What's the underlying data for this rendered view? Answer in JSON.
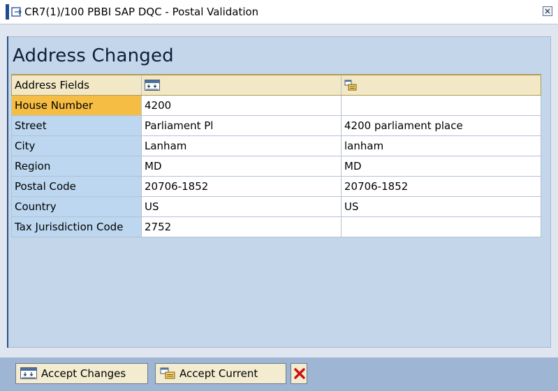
{
  "window": {
    "title": "CR7(1)/100 PBBI SAP DQC - Postal Validation"
  },
  "main": {
    "heading": "Address Changed"
  },
  "table": {
    "header": {
      "label": "Address Fields",
      "proposed_icon": "accept-changes-icon",
      "current_icon": "accept-current-icon"
    },
    "rows": [
      {
        "field": "House Number",
        "proposed": "4200",
        "current": "",
        "selected": true
      },
      {
        "field": "Street",
        "proposed": "Parliament Pl",
        "current": "4200 parliament place"
      },
      {
        "field": "City",
        "proposed": "Lanham",
        "current": "lanham"
      },
      {
        "field": "Region",
        "proposed": "MD",
        "current": "MD"
      },
      {
        "field": "Postal Code",
        "proposed": "20706-1852",
        "current": "20706-1852"
      },
      {
        "field": "Country",
        "proposed": "US",
        "current": "US"
      },
      {
        "field": "Tax Jurisdiction Code",
        "proposed": "2752",
        "current": ""
      }
    ]
  },
  "footer": {
    "accept_changes_label": "Accept Changes",
    "accept_current_label": "Accept Current",
    "cancel_icon": "cancel-x-icon"
  },
  "colors": {
    "selected_row": "#f5bd43",
    "row_label_bg": "#bcd7ef",
    "header_bg": "#f2e8c6",
    "footer_bg": "#9fb5d4",
    "cancel_red": "#cc1111"
  }
}
